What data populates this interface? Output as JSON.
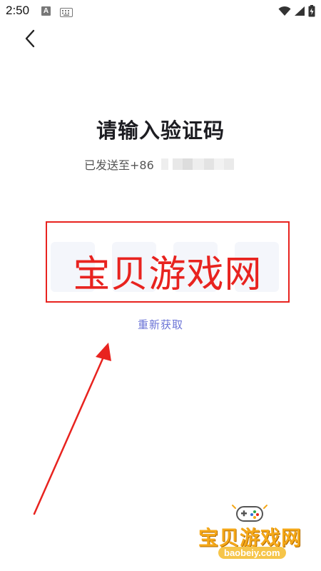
{
  "status_bar": {
    "time": "2:50",
    "app_badge": "A"
  },
  "header": {
    "title": "请输入验证码",
    "sent_to_label": "已发送至+86"
  },
  "code_input": {
    "box_count": 4
  },
  "resend_label": "重新获取",
  "watermark": {
    "text": "宝贝游戏网",
    "color": "#e8231f"
  },
  "corner_logo": {
    "text": "宝贝游戏网",
    "domain": "baobeiy.com"
  },
  "colors": {
    "link": "#6b74d6",
    "title": "#1d1d22",
    "code_box_bg": "#f4f6fb"
  }
}
